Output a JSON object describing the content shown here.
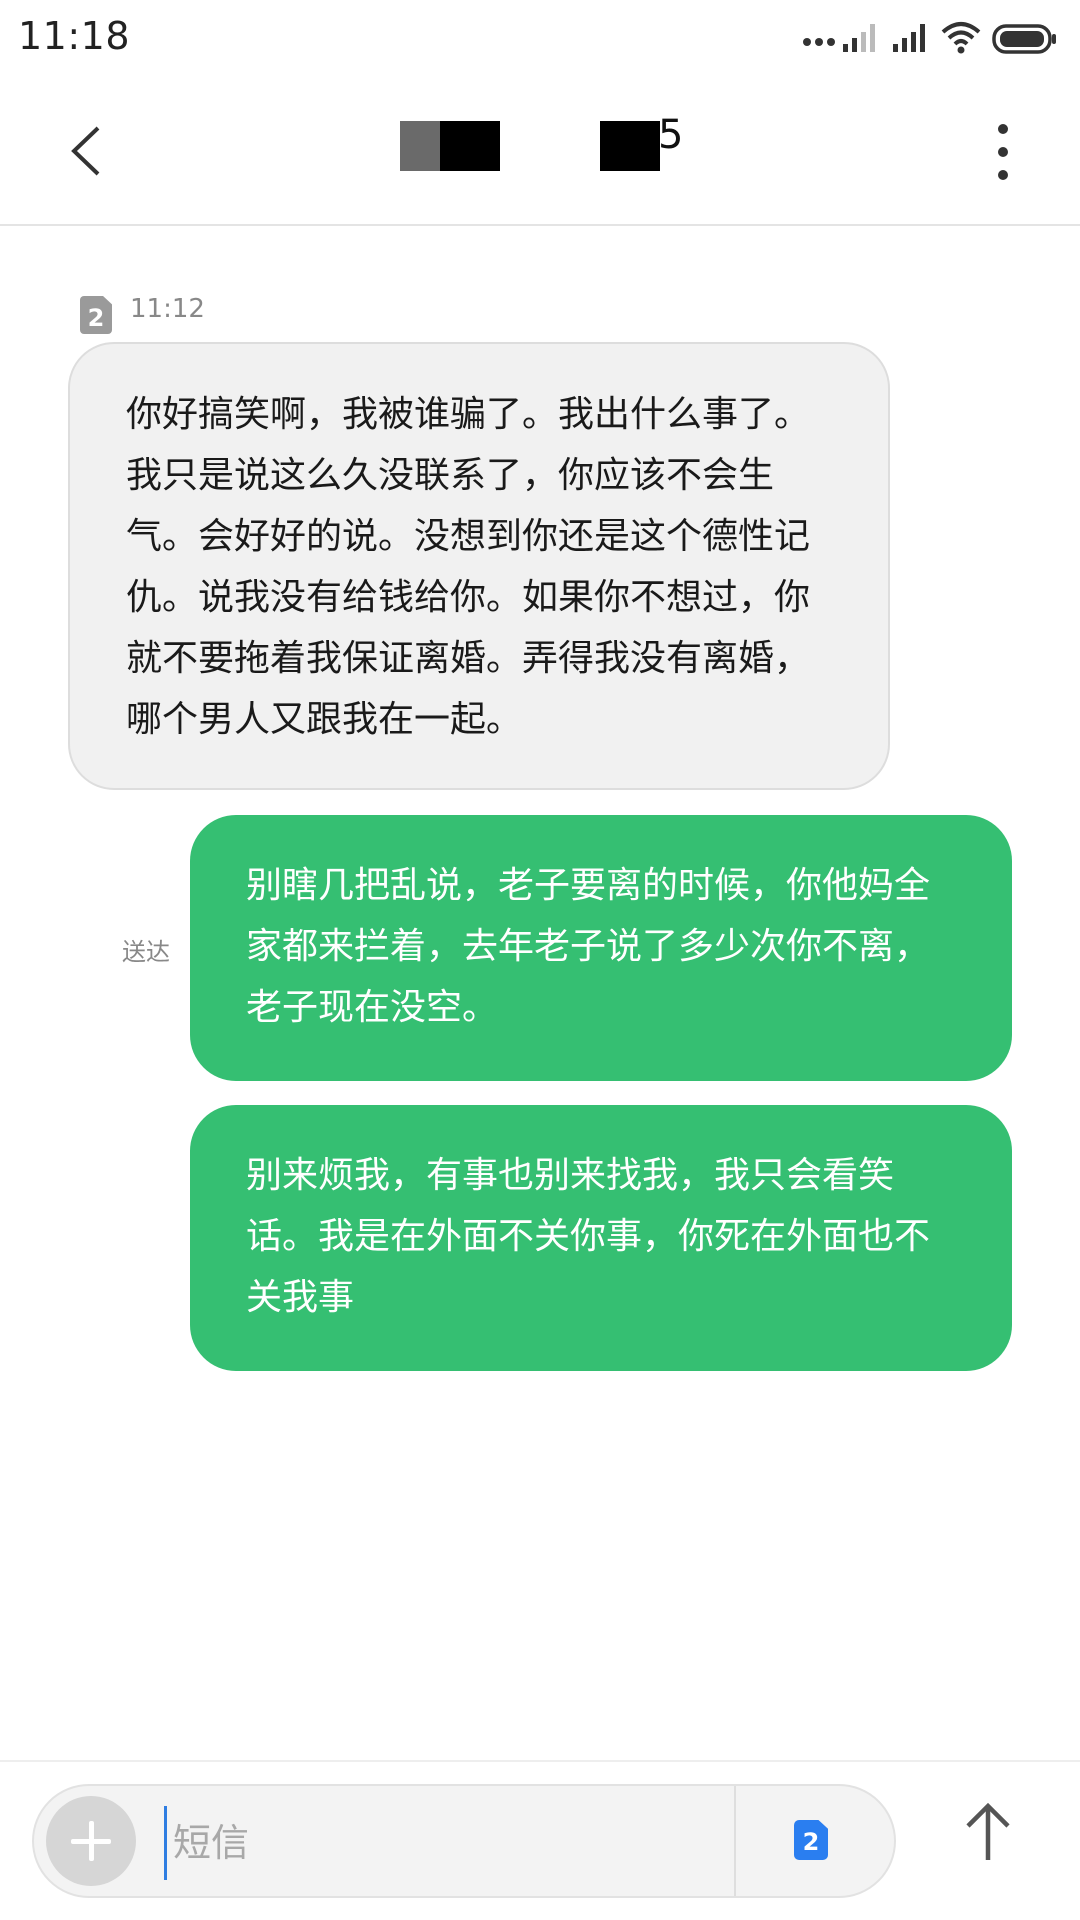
{
  "status_bar": {
    "time": "11:18",
    "icons": [
      "dots-icon",
      "signal-weak-icon",
      "signal-full-icon",
      "wifi-icon",
      "battery-icon"
    ]
  },
  "header": {
    "title_visible_suffix": "5",
    "back_icon": "chevron-left-icon",
    "menu_icon": "more-vertical-icon"
  },
  "messages": [
    {
      "direction": "incoming",
      "sim": "2",
      "time": "11:12",
      "lines": [
        "你好搞笑啊，我被谁骗了。我出什么事了。",
        "我只是说这么久没联系了，你应该不会生",
        "气。会好好的说。没想到你还是这个德性记",
        "仇。说我没有给钱给你。如果你不想过，你",
        "就不要拖着我保证离婚。弄得我没有离婚，",
        "哪个男人又跟我在一起。"
      ]
    },
    {
      "direction": "outgoing",
      "status": "送达",
      "lines": [
        "别瞎几把乱说，老子要离的时候，你他妈全",
        "家都来拦着，去年老子说了多少次你不离，",
        "老子现在没空。"
      ]
    },
    {
      "direction": "outgoing",
      "lines": [
        "别来烦我，有事也别来找我，我只会看笑",
        "话。我是在外面不关你事，你死在外面也不",
        "关我事"
      ]
    }
  ],
  "composer": {
    "placeholder": "短信",
    "value": "",
    "sim_label": "2",
    "add_icon": "plus-icon",
    "send_icon": "arrow-up-icon"
  },
  "colors": {
    "incoming_bubble": "#f1f1f1",
    "outgoing_bubble": "#35bf72",
    "sim_active": "#2a7ef0"
  }
}
